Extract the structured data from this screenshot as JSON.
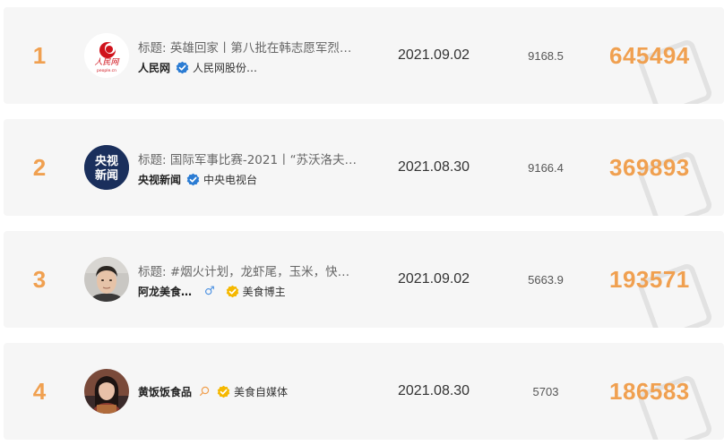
{
  "rows": [
    {
      "rank": "1",
      "title": "标题: 英雄回家丨第八批在韩志愿军烈…",
      "account": "人民网",
      "badge": "blue-verified",
      "verify": "人民网股份…",
      "date": "2021.09.02",
      "score": "9168.5",
      "count": "645494",
      "avatar": "people-daily-logo"
    },
    {
      "rank": "2",
      "title": "标题: 国际军事比赛-2021丨“苏沃洛夫…",
      "account": "央视新闻",
      "badge": "blue-verified",
      "verify": "中央电视台",
      "date": "2021.08.30",
      "score": "9166.4",
      "count": "369893",
      "avatar": "cctv-news-logo",
      "avatar_text": [
        "央视",
        "新闻"
      ]
    },
    {
      "rank": "3",
      "title": "标题: #烟火计划，龙虾尾，玉米，快…",
      "account": "阿龙美食…",
      "gender": "♂",
      "badge": "gold-verified",
      "verify": "美食博主",
      "date": "2021.09.02",
      "score": "5663.9",
      "count": "193571",
      "avatar": "man-portrait"
    },
    {
      "rank": "4",
      "title": "",
      "account": "黄饭饭食品",
      "badge": "gold-verified",
      "verify": "美食自媒体",
      "date": "2021.08.30",
      "score": "5703",
      "count": "186583",
      "avatar": "woman-portrait"
    }
  ],
  "colors": {
    "rank": "#f0a050",
    "count": "#f0a050",
    "row_bg": "#f6f6f6",
    "blue_badge": "#2b7cd3",
    "gold_badge": "#f5b800"
  }
}
